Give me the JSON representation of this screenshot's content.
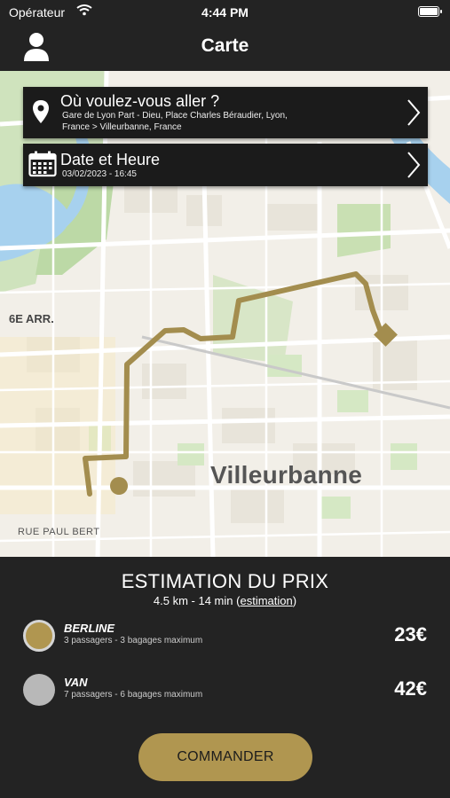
{
  "status_bar": {
    "carrier": "Opérateur",
    "time": "4:44 PM"
  },
  "nav": {
    "title": "Carte"
  },
  "map": {
    "city_label": "Villeurbanne",
    "district_label": "6E ARR.",
    "street_label": "RUE PAUL BERT"
  },
  "destination": {
    "title": "Où voulez-vous aller ?",
    "detail_line1": "Gare de Lyon Part - Dieu, Place Charles Béraudier, Lyon,",
    "detail_line2": "France > Villeurbanne, France"
  },
  "datetime": {
    "title": "Date et Heure",
    "value": "03/02/2023 - 16:45"
  },
  "estimate": {
    "title": "ESTIMATION DU PRIX",
    "summary": "4.5 km - 14 min",
    "link": "estimation",
    "paren_open": "(",
    "paren_close": ")"
  },
  "vehicles": [
    {
      "name": "BERLINE",
      "description": "3 passagers - 3 bagages maximum",
      "price": "23€",
      "selected": true
    },
    {
      "name": "VAN",
      "description": "7 passagers - 6 bagages maximum",
      "price": "42€",
      "selected": false
    }
  ],
  "actions": {
    "order_label": "COMMANDER"
  },
  "colors": {
    "accent": "#b09650",
    "background": "#232323",
    "card": "#1b1b1b",
    "route": "#a38d4e"
  },
  "icons": [
    "wifi-icon",
    "battery-icon",
    "user-icon",
    "location-pin-icon",
    "calendar-icon",
    "chevron-right-icon"
  ]
}
